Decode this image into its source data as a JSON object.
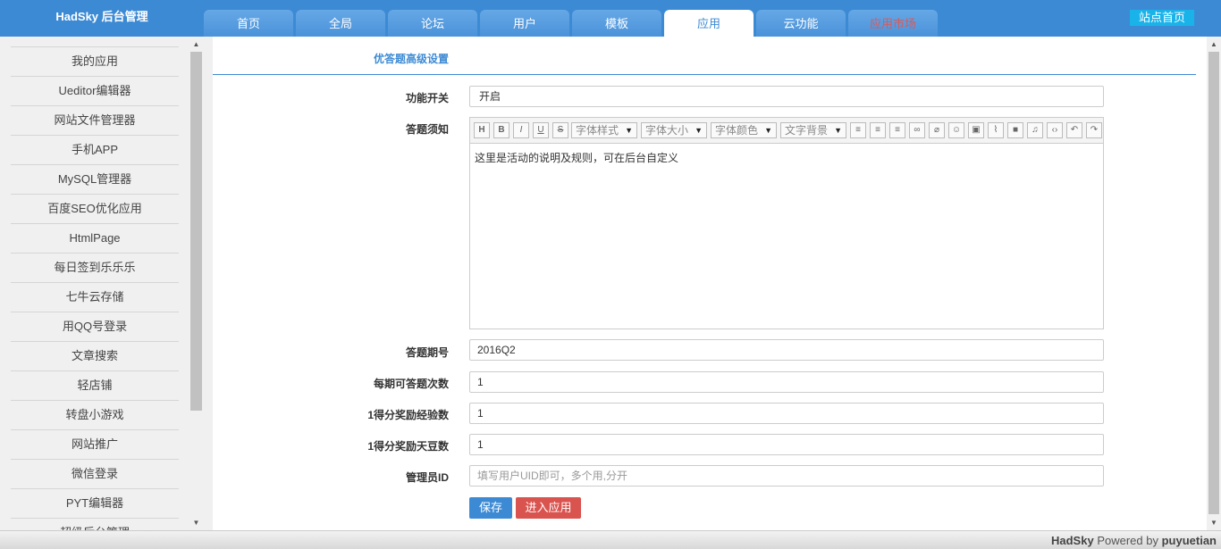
{
  "header": {
    "brand": "HadSky 后台管理",
    "tabs": [
      {
        "label": "首页",
        "active": false
      },
      {
        "label": "全局",
        "active": false
      },
      {
        "label": "论坛",
        "active": false
      },
      {
        "label": "用户",
        "active": false
      },
      {
        "label": "模板",
        "active": false
      },
      {
        "label": "应用",
        "active": true
      },
      {
        "label": "云功能",
        "active": false
      },
      {
        "label": "应用市场",
        "active": false
      }
    ],
    "site_home": "站点首页"
  },
  "sidebar": {
    "items": [
      {
        "label": "我的应用"
      },
      {
        "label": "Ueditor编辑器"
      },
      {
        "label": "网站文件管理器"
      },
      {
        "label": "手机APP"
      },
      {
        "label": "MySQL管理器"
      },
      {
        "label": "百度SEO优化应用"
      },
      {
        "label": "HtmlPage"
      },
      {
        "label": "每日签到乐乐乐"
      },
      {
        "label": "七牛云存储"
      },
      {
        "label": "用QQ号登录"
      },
      {
        "label": "文章搜索"
      },
      {
        "label": "轻店铺"
      },
      {
        "label": "转盘小游戏"
      },
      {
        "label": "网站推广"
      },
      {
        "label": "微信登录"
      },
      {
        "label": "PYT编辑器"
      },
      {
        "label": "超级后台管理"
      }
    ]
  },
  "main": {
    "title": "优答题高级设置",
    "fields": {
      "switch": {
        "label": "功能开关",
        "value": "开启"
      },
      "notice": {
        "label": "答题须知"
      },
      "period": {
        "label": "答题期号",
        "value": "2016Q2"
      },
      "times": {
        "label": "每期可答题次数",
        "value": "1"
      },
      "exp": {
        "label": "1得分奖励经验数",
        "value": "1"
      },
      "beans": {
        "label": "1得分奖励天豆数",
        "value": "1"
      },
      "admin": {
        "label": "管理员ID",
        "placeholder": "填写用户UID即可，多个用,分开"
      }
    },
    "editor": {
      "toolbar_buttons_left": [
        {
          "glyph": "H",
          "icon": "heading-icon"
        },
        {
          "glyph": "B",
          "icon": "bold-icon"
        },
        {
          "glyph": "I",
          "icon": "italic-icon"
        },
        {
          "glyph": "U",
          "icon": "underline-icon"
        },
        {
          "glyph": "S",
          "icon": "strikethrough-icon"
        }
      ],
      "selects": [
        "字体样式",
        "字体大小",
        "字体颜色",
        "文字背景"
      ],
      "content": "这里是活动的说明及规则，可在后台自定义"
    },
    "buttons": {
      "save": "保存",
      "enter": "进入应用"
    },
    "colors": {
      "primary": "#3d8ad4",
      "danger": "#d9534f"
    }
  },
  "footer": {
    "brand": "HadSky",
    "powered": "Powered by",
    "author": "puyuetian"
  }
}
